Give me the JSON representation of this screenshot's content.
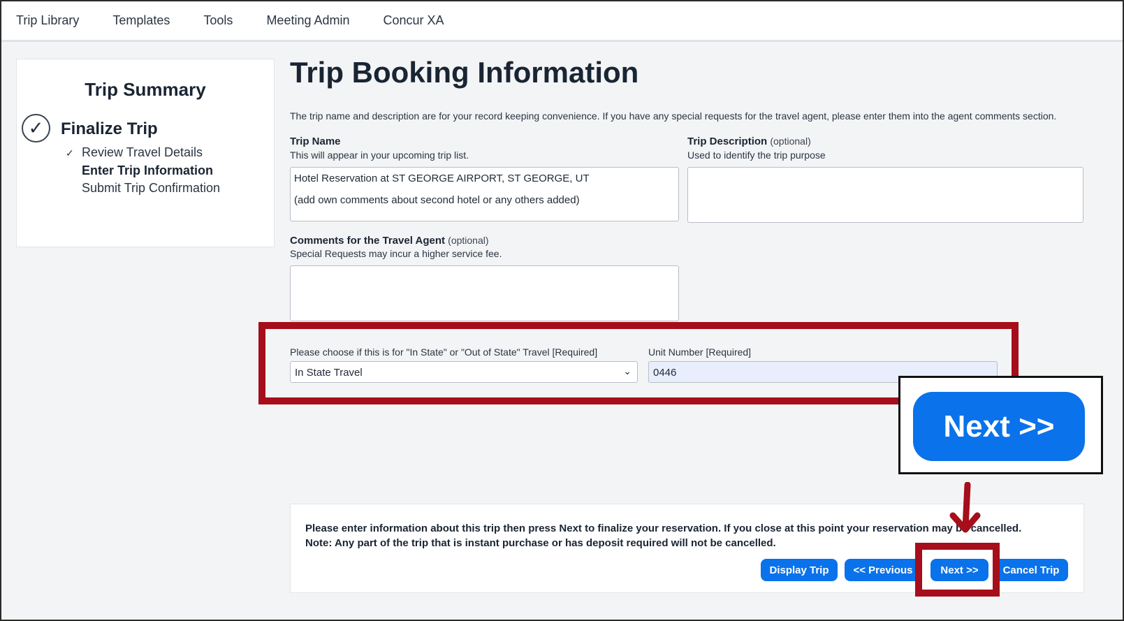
{
  "nav": [
    "Trip Library",
    "Templates",
    "Tools",
    "Meeting Admin",
    "Concur XA"
  ],
  "sidebar": {
    "title": "Trip Summary",
    "section": "Finalize Trip",
    "steps": [
      "Review Travel Details",
      "Enter Trip Information",
      "Submit Trip Confirmation"
    ]
  },
  "main": {
    "title": "Trip Booking Information",
    "intro": "The trip name and description are for your record keeping convenience. If you have any special requests for the travel agent, please enter them into the agent comments section.",
    "trip_name": {
      "label": "Trip Name",
      "hint": "This will appear in your upcoming trip list.",
      "value": "Hotel Reservation at ST GEORGE AIRPORT, ST GEORGE, UT\n\n(add own comments about second hotel or any others added)"
    },
    "trip_desc": {
      "label": "Trip Description",
      "optional": "(optional)",
      "hint": "Used to identify the trip purpose",
      "value": ""
    },
    "comments": {
      "label": "Comments for the Travel Agent",
      "optional": "(optional)",
      "hint": "Special Requests may incur a higher service fee.",
      "value": ""
    },
    "state": {
      "label": "Please choose if this is for \"In State\" or \"Out of State\" Travel [Required]",
      "value": "In State Travel"
    },
    "unit": {
      "label": "Unit Number [Required]",
      "value": "0446"
    }
  },
  "footer": {
    "line1": "Please enter information about this trip then press Next to finalize your reservation. If you close at this point your reservation may be cancelled.",
    "line2": "Note: Any part of the trip that is instant purchase or has deposit required will not be cancelled.",
    "buttons": {
      "display": "Display Trip",
      "previous": "<< Previous",
      "next": "Next >>",
      "cancel": "Cancel Trip"
    }
  },
  "callout": {
    "label": "Next >>"
  },
  "colors": {
    "accent": "#0a72ea",
    "highlight": "#a50e1a"
  }
}
